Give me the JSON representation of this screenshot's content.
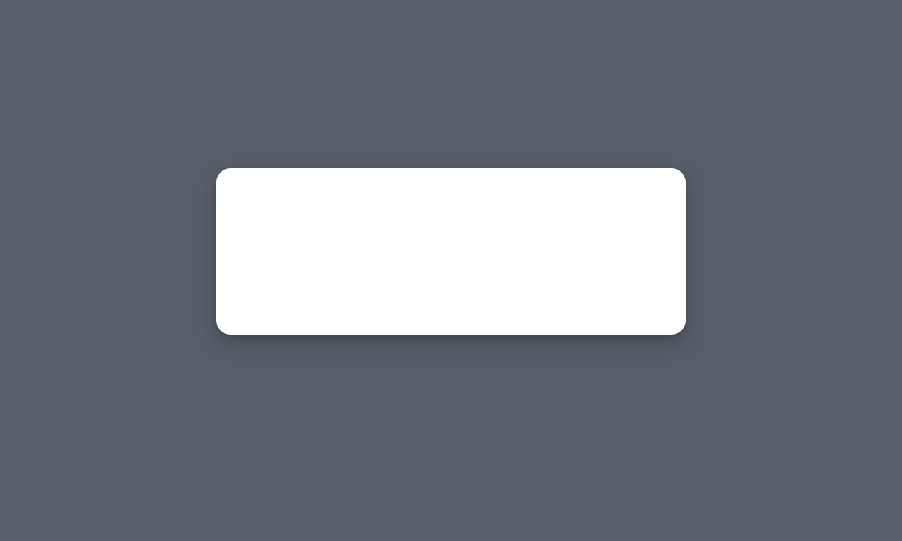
{
  "colors": {
    "overlay_background": "#595e6a",
    "dialog_background": "#ffffff"
  },
  "dialog": {
    "content": ""
  }
}
